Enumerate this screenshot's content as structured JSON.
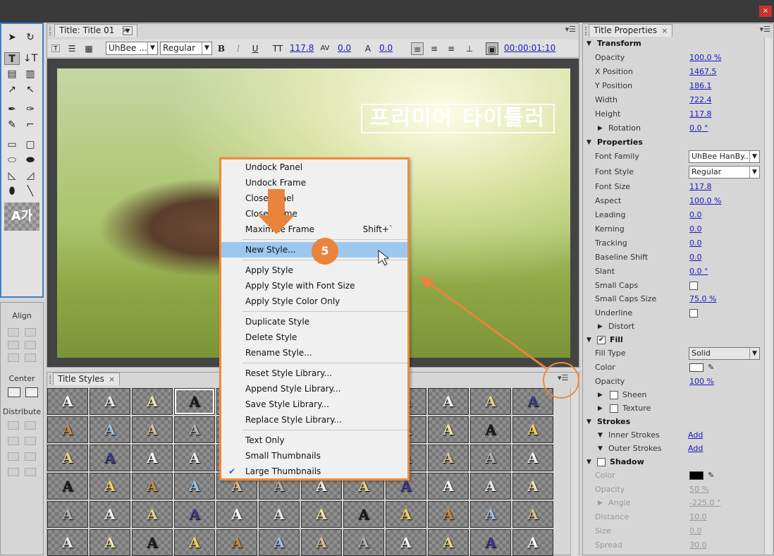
{
  "window": {
    "close_glyph": "×"
  },
  "tools_panel": {
    "preview_text": "A가"
  },
  "align_panel": {
    "align_label": "Align",
    "center_label": "Center",
    "distribute_label": "Distribute"
  },
  "title_panel": {
    "tab_label": "Title: Title 01",
    "font_family": "UhBee ...",
    "font_style": "Regular",
    "bold": "B",
    "italic": "I",
    "underline": "U",
    "font_size": "117.8",
    "kerning": "0.0",
    "baseline": "0.0",
    "timecode": "00:00:01:10",
    "overlay_text": "프리미어 타이틀러"
  },
  "styles_panel": {
    "tab_label": "Title Styles"
  },
  "context_menu": {
    "items": [
      {
        "label": "Undock Panel"
      },
      {
        "label": "Undock Frame"
      },
      {
        "label": "Close Panel"
      },
      {
        "label": "Close Frame"
      },
      {
        "label": "Maximize Frame",
        "shortcut": "Shift+`"
      },
      {
        "label": "New Style..."
      },
      {
        "label": "Apply Style"
      },
      {
        "label": "Apply Style with Font Size"
      },
      {
        "label": "Apply Style Color Only"
      },
      {
        "label": "Duplicate Style"
      },
      {
        "label": "Delete Style"
      },
      {
        "label": "Rename Style..."
      },
      {
        "label": "Reset Style Library..."
      },
      {
        "label": "Append Style Library..."
      },
      {
        "label": "Save Style Library..."
      },
      {
        "label": "Replace Style Library..."
      },
      {
        "label": "Text Only"
      },
      {
        "label": "Small Thumbnails"
      },
      {
        "label": "Large Thumbnails"
      }
    ],
    "check_glyph": "✔"
  },
  "annotation": {
    "step_number": "5"
  },
  "properties": {
    "tab_label": "Title Properties",
    "transform": "Transform",
    "opacity_lbl": "Opacity",
    "opacity_val": "100.0 %",
    "xpos_lbl": "X Position",
    "xpos_val": "1467.5",
    "ypos_lbl": "Y Position",
    "ypos_val": "186.1",
    "width_lbl": "Width",
    "width_val": "722.4",
    "height_lbl": "Height",
    "height_val": "117.8",
    "rotation_lbl": "Rotation",
    "rotation_val": "0.0 °",
    "properties": "Properties",
    "font_family_lbl": "Font Family",
    "font_family_val": "UhBee HanBy...",
    "font_style_lbl": "Font Style",
    "font_style_val": "Regular",
    "font_size_lbl": "Font Size",
    "font_size_val": "117.8",
    "aspect_lbl": "Aspect",
    "aspect_val": "100.0 %",
    "leading_lbl": "Leading",
    "leading_val": "0.0",
    "kerning_lbl": "Kerning",
    "kerning_val": "0.0",
    "tracking_lbl": "Tracking",
    "tracking_val": "0.0",
    "baseline_lbl": "Baseline Shift",
    "baseline_val": "0.0",
    "slant_lbl": "Slant",
    "slant_val": "0.0 °",
    "smallcaps_lbl": "Small Caps",
    "smallcaps_size_lbl": "Small Caps Size",
    "smallcaps_size_val": "75.0 %",
    "underline_lbl": "Underline",
    "distort_lbl": "Distort",
    "fill": "Fill",
    "filltype_lbl": "Fill Type",
    "filltype_val": "Solid",
    "color_lbl": "Color",
    "fill_opacity_lbl": "Opacity",
    "fill_opacity_val": "100 %",
    "sheen_lbl": "Sheen",
    "texture_lbl": "Texture",
    "strokes": "Strokes",
    "inner_lbl": "Inner Strokes",
    "inner_add": "Add",
    "outer_lbl": "Outer Strokes",
    "outer_add": "Add",
    "shadow": "Shadow",
    "sh_color_lbl": "Color",
    "sh_opacity_lbl": "Opacity",
    "sh_opacity_val": "50 %",
    "sh_angle_lbl": "Angle",
    "sh_angle_val": "-225.0 °",
    "sh_distance_lbl": "Distance",
    "sh_distance_val": "10.0",
    "sh_size_lbl": "Size",
    "sh_size_val": "0.0",
    "sh_spread_lbl": "Spread",
    "sh_spread_val": "30.0",
    "check_glyph": "✔"
  },
  "colors": {
    "accent": "#f08a3a",
    "highlight": "#9cc8ef",
    "link": "#1a1ac0"
  }
}
